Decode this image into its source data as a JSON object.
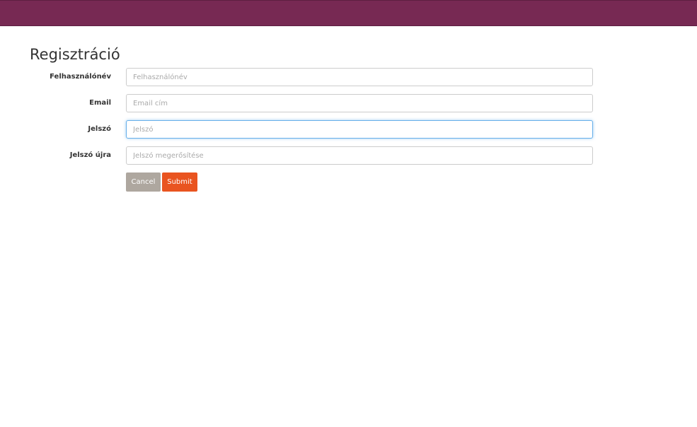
{
  "form": {
    "title": "Regisztráció",
    "fields": [
      {
        "label": "Felhasználónév",
        "placeholder": "Felhasználónév",
        "value": ""
      },
      {
        "label": "Email",
        "placeholder": "Email cím",
        "value": ""
      },
      {
        "label": "Jelszó",
        "placeholder": "Jelszó",
        "value": ""
      },
      {
        "label": "Jelszó újra",
        "placeholder": "Jelszó megerősítése",
        "value": ""
      }
    ],
    "cancel_label": "Cancel",
    "submit_label": "Submit"
  },
  "colors": {
    "navbar": "#772953",
    "cancel": "#aea79f",
    "submit": "#e95420",
    "focus": "#66afe9"
  }
}
